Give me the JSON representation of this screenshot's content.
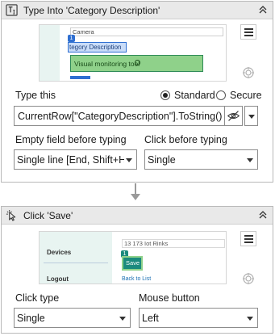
{
  "activity1": {
    "title": "Type Into 'Category Description'",
    "preview": {
      "field_text": "Camera",
      "badge": "1",
      "highlight_text": "tegory Description",
      "selected_text": "Visual monitoring tool"
    },
    "type_this_label": "Type this",
    "radio_standard": "Standard",
    "radio_secure": "Secure",
    "radio_selected": "Standard",
    "expression": "CurrentRow[\"CategoryDescription\"].ToString()",
    "empty_field_label": "Empty field before typing",
    "empty_field_value": "Single line [End, Shift+H",
    "click_before_label": "Click before typing",
    "click_before_value": "Single"
  },
  "activity2": {
    "title": "Click 'Save'",
    "preview": {
      "devices": "Devices",
      "logout": "Logout",
      "top_text": "13  173  Iot Rinks",
      "save_label": "Save",
      "badge": "1",
      "back_link": "Back to List"
    },
    "click_type_label": "Click type",
    "click_type_value": "Single",
    "mouse_button_label": "Mouse button",
    "mouse_button_value": "Left"
  },
  "colors": {
    "header_bg": "#e9e9e9",
    "green_highlight": "#8fd18a",
    "blue_selection": "#2f6fd1",
    "teal_button": "#1b8a7d",
    "connector": "#9a9a9a"
  },
  "icons": {
    "type_into": "text-cursor-icon",
    "click": "mouse-click-icon",
    "collapse": "double-chevron-up-icon",
    "menu": "hamburger-menu-icon",
    "target": "target-indicator-icon",
    "eye": "eye-slash-icon"
  }
}
